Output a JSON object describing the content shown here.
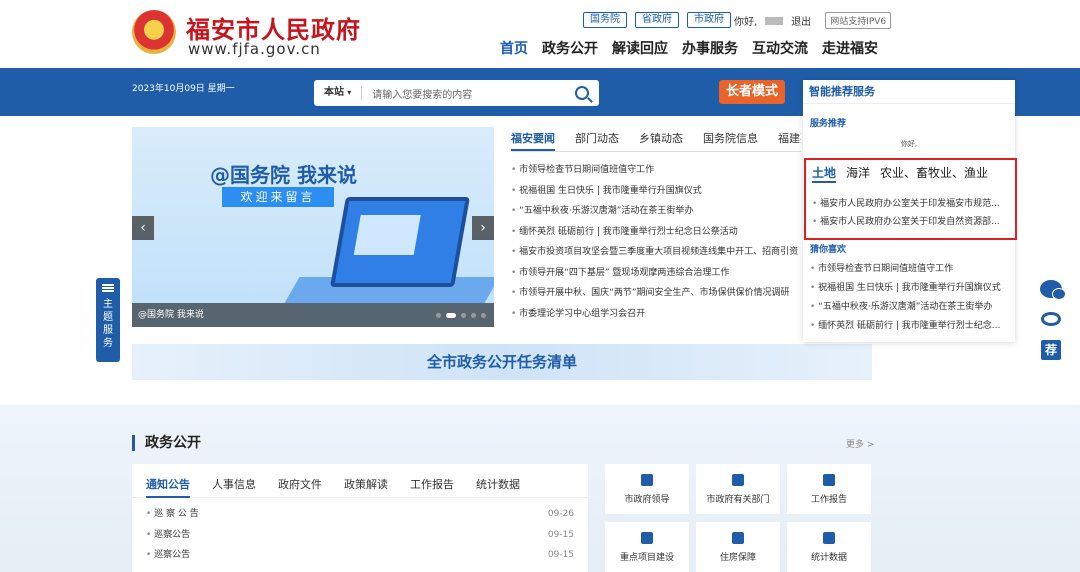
{
  "header": {
    "site_title": "福安市人民政府",
    "site_domain": "www.fjfa.gov.cn",
    "top_links": [
      "国务院",
      "省政府",
      "市政府"
    ],
    "greeting": "你好,",
    "logout": "退出",
    "ipv6": "网站支持IPV6",
    "nav": [
      "首页",
      "政务公开",
      "解读回应",
      "办事服务",
      "互动交流",
      "走进福安"
    ]
  },
  "band": {
    "date": "2023年10月09日 星期一",
    "search_scope": "本站",
    "search_placeholder": "请输入您要搜索的内容",
    "elder_mode": "长者模式"
  },
  "carousel": {
    "headline": "@国务院 我来说",
    "subline": "欢迎来留言",
    "caption": "@国务院 我来说"
  },
  "news": {
    "tabs": [
      "福安要闻",
      "部门动态",
      "乡镇动态",
      "国务院信息",
      "福建要闻"
    ],
    "items": [
      "市领导检查节日期间值班值守工作",
      "祝福祖国 生日快乐 | 我市隆重举行升国旗仪式",
      "“五福中秋夜·乐游汉唐潮”活动在茶王街举办",
      "缅怀英烈 砥砺前行 | 我市隆重举行烈士纪念日公祭活动",
      "福安市投资项目攻坚会暨三季度重大项目视频连线集中开工、招商引资",
      "市领导开展“四下基层” 暨现场观摩两违综合治理工作",
      "市领导开展中秋、国庆“两节”期间安全生产、市场保供保价情况调研",
      "市委理论学习中心组学习会召开"
    ]
  },
  "strip": "全市政务公开任务清单",
  "left_float": [
    "主",
    "题",
    "服",
    "务"
  ],
  "recommend": {
    "title": "智能推荐服务",
    "service_head": "服务推荐",
    "hello": "你好,",
    "focus_tabs": [
      "土地",
      "海洋",
      "农业、畜牧业、渔业"
    ],
    "focus_items": [
      "福安市人民政府办公室关于印发福安市规范...",
      "福安市人民政府办公室关于印发自然资源部..."
    ],
    "guess_head": "猜你喜欢",
    "guess_items": [
      "市领导检查节日期间值班值守工作",
      "祝福祖国 生日快乐 | 我市隆重举行升国旗仪式",
      "“五福中秋夜·乐游汉唐潮”活动在茶王街举办",
      "缅怀英烈 砥砺前行 | 我市隆重举行烈士纪念..."
    ]
  },
  "social": {
    "rec_label": "荐"
  },
  "lower": {
    "section_title": "政务公开",
    "more": "更多 >",
    "notice_tabs": [
      "通知公告",
      "人事信息",
      "政府文件",
      "政策解读",
      "工作报告",
      "统计数据"
    ],
    "notices": [
      {
        "title": "巡 察 公 告",
        "date": "09-26"
      },
      {
        "title": "巡察公告",
        "date": "09-15"
      },
      {
        "title": "巡察公告",
        "date": "09-15"
      }
    ],
    "tiles": [
      "市政府领导",
      "市政府有关部门",
      "工作报告",
      "重点项目建设",
      "住房保障",
      "统计数据"
    ]
  }
}
